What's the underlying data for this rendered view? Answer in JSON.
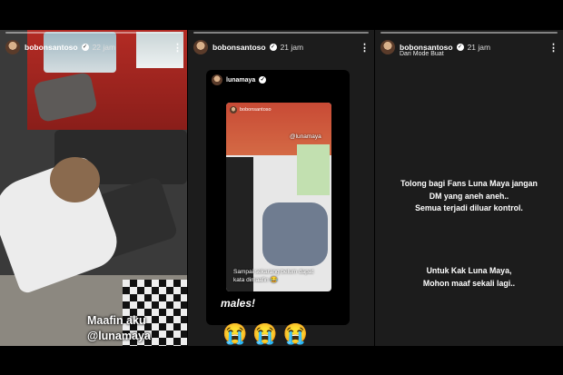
{
  "stories": [
    {
      "user": "bobonsantoso",
      "time": "22 jam",
      "caption": [
        "Maafin aku",
        "@lunamaya"
      ]
    },
    {
      "user": "bobonsantoso",
      "time": "21 jam",
      "repost": {
        "user": "lunamaya",
        "inner_user": "bobonsantoso",
        "inner_tag": "@lunamaya",
        "inner_caption": "Sampai sekarang belum dapat kata dimaafin 😂",
        "caption": "males!"
      },
      "emojis": "😭😭😭"
    },
    {
      "user": "bobonsantoso",
      "time": "21 jam",
      "subline": "Dari Mode Buat",
      "paragraph1": [
        "Tolong bagi Fans Luna Maya jangan",
        "DM yang aneh aneh..",
        "Semua terjadi diluar kontrol."
      ],
      "paragraph2": [
        "Untuk Kak Luna Maya,",
        "Mohon maaf sekali lagi.."
      ]
    }
  ],
  "icons": {
    "verified": "verified-badge-icon",
    "more": "more-options-icon"
  }
}
